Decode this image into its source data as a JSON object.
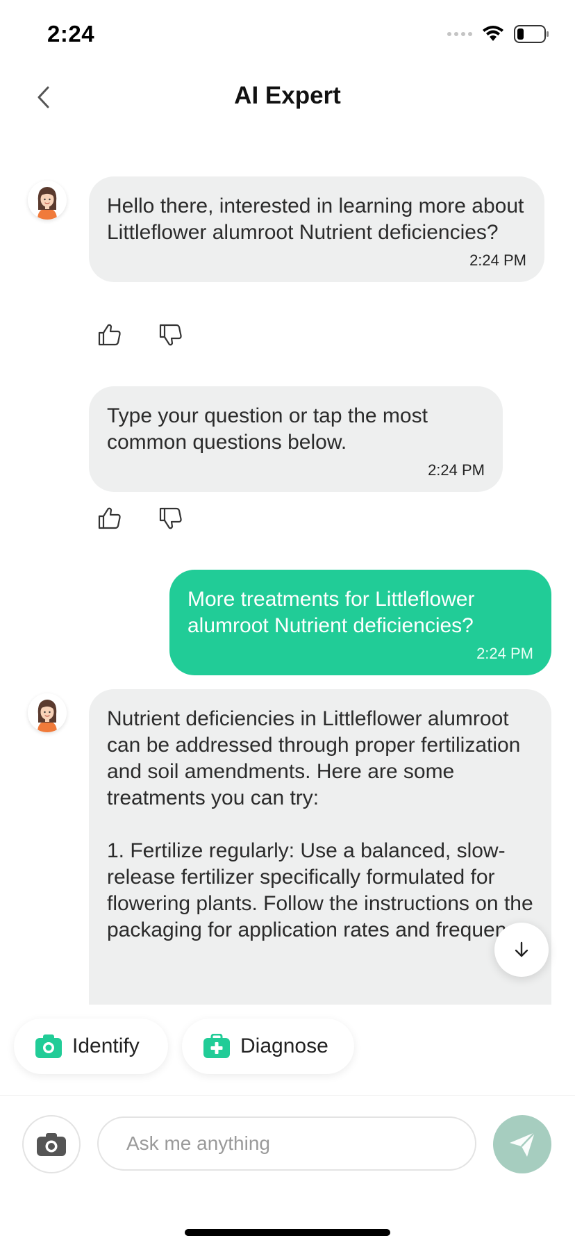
{
  "status_bar": {
    "time": "2:24"
  },
  "header": {
    "title": "AI Expert"
  },
  "messages": [
    {
      "sender": "bot",
      "text": "Hello there, interested in learning more about Littleflower alumroot Nutrient deficiencies?",
      "time": "2:24 PM"
    },
    {
      "sender": "bot",
      "text": "Type your question or tap the most common questions below.",
      "time": "2:24 PM"
    },
    {
      "sender": "user",
      "text": "More treatments for Littleflower alumroot Nutrient deficiencies?",
      "time": "2:24 PM"
    },
    {
      "sender": "bot",
      "text": "Nutrient deficiencies in Littleflower alumroot can be addressed through proper fertilization and soil amendments. Here are some treatments you can try:\n\n1. Fertilize regularly: Use a balanced, slow-release fertilizer specifically formulated for flowering plants. Follow the instructions on the packaging for application rates and frequency."
    }
  ],
  "quick_actions": {
    "identify_label": "Identify",
    "diagnose_label": "Diagnose"
  },
  "input": {
    "placeholder": "Ask me anything"
  },
  "colors": {
    "accent": "#21cc97",
    "bot_bubble": "#eeefef",
    "send_disabled": "#a6cdbf"
  }
}
